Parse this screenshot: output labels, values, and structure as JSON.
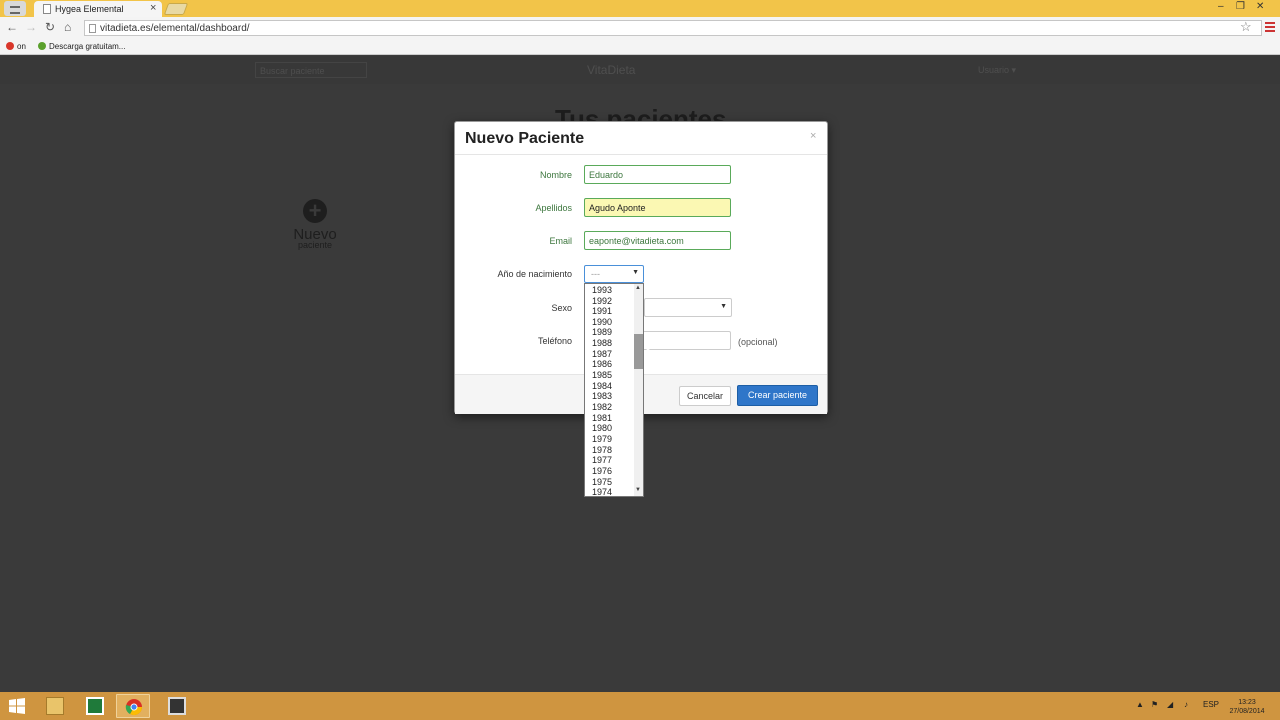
{
  "browser": {
    "tab_title": "Hygea Elemental",
    "tab_close": "×",
    "url": "vitadieta.es/elemental/dashboard/",
    "back": "←",
    "forward": "→",
    "reload": "↻",
    "home": "⌂",
    "star": "☆",
    "win_min": "–",
    "win_max": "❐",
    "win_close": "✕",
    "bookmarks": [
      {
        "label": "on",
        "icon": "red-circle-icon",
        "color": "#d9362a"
      },
      {
        "label": "Descarga gratuitam...",
        "icon": "leaf-icon",
        "color": "#5aa02c"
      }
    ]
  },
  "app": {
    "search_placeholder": "Buscar paciente",
    "brand": "VitaDieta",
    "user_menu": "Usuario ▾",
    "page_title": "Tus pacientes",
    "new_patient_plus": "+",
    "new_patient_line1": "Nuevo",
    "new_patient_line2": "paciente"
  },
  "modal": {
    "title": "Nuevo Paciente",
    "close": "×",
    "fields": {
      "nombre_label": "Nombre",
      "nombre_value": "Eduardo",
      "apellidos_label": "Apellidos",
      "apellidos_value": "Agudo Aponte",
      "email_label": "Email",
      "email_value": "eaponte@vitadieta.com",
      "anio_label": "Año de nacimiento",
      "anio_value": "---",
      "sexo_label": "Sexo",
      "telefono_label": "Teléfono",
      "telefono_hint": "(opcional)"
    },
    "cancel_label": "Cancelar",
    "create_label": "Crear paciente"
  },
  "year_options": [
    "1993",
    "1992",
    "1991",
    "1990",
    "1989",
    "1988",
    "1987",
    "1986",
    "1985",
    "1984",
    "1983",
    "1982",
    "1981",
    "1980",
    "1979",
    "1978",
    "1977",
    "1976",
    "1975",
    "1974"
  ],
  "taskbar": {
    "tray_lang": "ESP",
    "clock_time": "13:23",
    "clock_date": "27/08/2014"
  },
  "colors": {
    "accent": "#2f76c9",
    "success": "#3c763d",
    "taskbar": "#cf9540",
    "titlebar": "#f2c449"
  }
}
